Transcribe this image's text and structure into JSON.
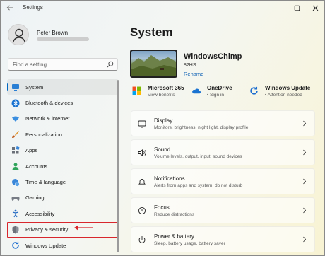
{
  "window": {
    "title": "Settings",
    "controls": [
      "minimize-icon",
      "maximize-icon",
      "close-icon"
    ]
  },
  "profile": {
    "name": "Peter Brown"
  },
  "search": {
    "placeholder": "Find a setting",
    "icon": "search-icon"
  },
  "sidebar": {
    "items": [
      {
        "label": "System",
        "icon": "monitor-icon",
        "selected": true
      },
      {
        "label": "Bluetooth & devices",
        "icon": "bluetooth-icon"
      },
      {
        "label": "Network & internet",
        "icon": "wifi-icon"
      },
      {
        "label": "Personalization",
        "icon": "brush-icon"
      },
      {
        "label": "Apps",
        "icon": "apps-icon"
      },
      {
        "label": "Accounts",
        "icon": "account-icon"
      },
      {
        "label": "Time & language",
        "icon": "globe-clock-icon"
      },
      {
        "label": "Gaming",
        "icon": "gamepad-icon"
      },
      {
        "label": "Accessibility",
        "icon": "accessibility-icon"
      },
      {
        "label": "Privacy & security",
        "icon": "shield-icon",
        "highlighted": true
      },
      {
        "label": "Windows Update",
        "icon": "update-icon"
      }
    ]
  },
  "main": {
    "title": "System",
    "device": {
      "name": "WindowsChimp",
      "model": "82HS",
      "rename_label": "Rename"
    },
    "quick_links": [
      {
        "title": "Microsoft 365",
        "subtitle": "View benefits",
        "icon": "microsoft-365-icon"
      },
      {
        "title": "OneDrive",
        "subtitle": "• Sign in",
        "icon": "onedrive-icon"
      },
      {
        "title": "Windows Update",
        "subtitle": "• Attention needed",
        "icon": "windows-update-icon"
      }
    ],
    "cards": [
      {
        "title": "Display",
        "subtitle": "Monitors, brightness, night light, display profile",
        "icon": "display-icon"
      },
      {
        "title": "Sound",
        "subtitle": "Volume levels, output, input, sound devices",
        "icon": "speaker-icon"
      },
      {
        "title": "Notifications",
        "subtitle": "Alerts from apps and system, do not disturb",
        "icon": "bell-icon"
      },
      {
        "title": "Focus",
        "subtitle": "Reduce distractions",
        "icon": "focus-icon"
      },
      {
        "title": "Power & battery",
        "subtitle": "Sleep, battery usage, battery saver",
        "icon": "power-icon"
      }
    ]
  },
  "colors": {
    "accent": "#0067c0",
    "annotation_red": "#d8272d",
    "link": "#0a5fb4"
  }
}
